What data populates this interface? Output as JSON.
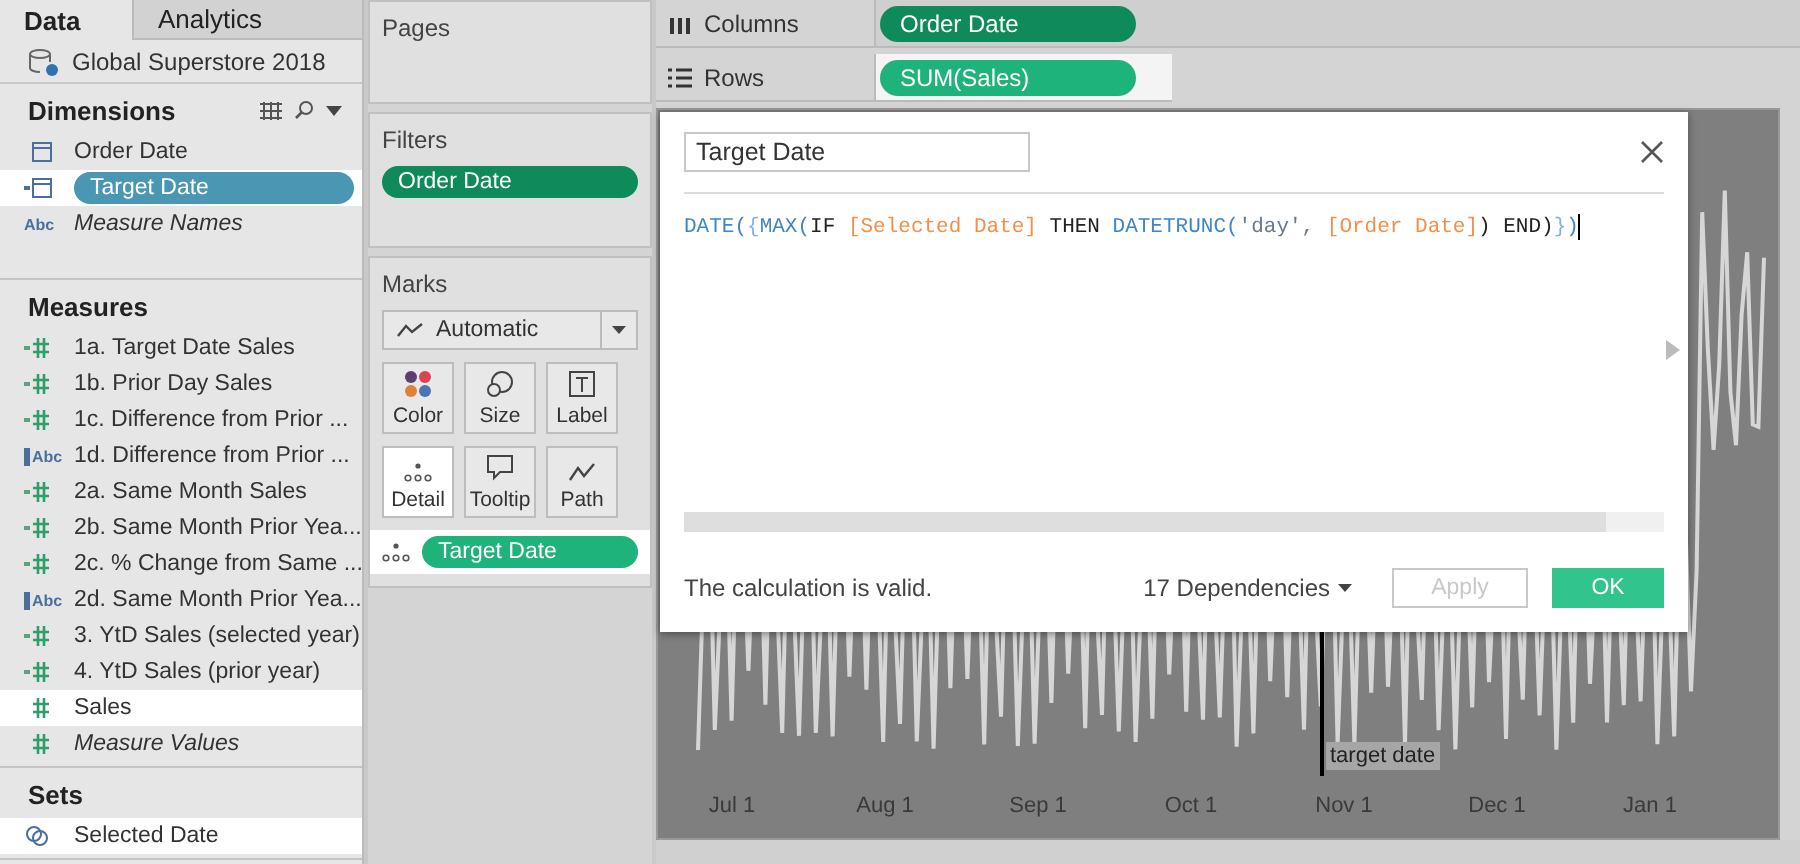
{
  "sidebar": {
    "tabs": [
      {
        "label": "Data",
        "selected": true
      },
      {
        "label": "Analytics",
        "selected": false
      }
    ],
    "data_source": "Global Superstore 2018",
    "sections": [
      {
        "title": "Dimensions",
        "tools": true,
        "items": [
          {
            "label": "Order Date",
            "kind": "date",
            "calculated": false,
            "italic": false,
            "highlighted": false,
            "pill": false
          },
          {
            "label": "Target Date",
            "kind": "date",
            "calculated": true,
            "italic": false,
            "highlighted": true,
            "pill": true
          },
          {
            "label": "Measure Names",
            "kind": "text",
            "type_label": "Abc",
            "calculated": false,
            "italic": true,
            "highlighted": false,
            "pill": false
          }
        ]
      },
      {
        "title": "Measures",
        "items": [
          {
            "label": "1a. Target Date Sales",
            "kind": "number",
            "calculated": true,
            "italic": false,
            "highlighted": false,
            "pill": false
          },
          {
            "label": "1b. Prior Day Sales",
            "kind": "number",
            "calculated": true,
            "italic": false,
            "highlighted": false,
            "pill": false
          },
          {
            "label": "1c. Difference from Prior ...",
            "kind": "number",
            "calculated": true,
            "italic": false,
            "highlighted": false,
            "pill": false
          },
          {
            "label": "1d. Difference from Prior ...",
            "kind": "text",
            "type_label": "Abc",
            "calculated": true,
            "italic": false,
            "highlighted": false,
            "pill": false
          },
          {
            "label": "2a. Same Month Sales",
            "kind": "number",
            "calculated": true,
            "italic": false,
            "highlighted": false,
            "pill": false
          },
          {
            "label": "2b. Same Month Prior Yea...",
            "kind": "number",
            "calculated": true,
            "italic": false,
            "highlighted": false,
            "pill": false
          },
          {
            "label": "2c. % Change from Same ...",
            "kind": "number",
            "calculated": true,
            "italic": false,
            "highlighted": false,
            "pill": false
          },
          {
            "label": "2d. Same Month Prior Yea...",
            "kind": "text",
            "type_label": "Abc",
            "calculated": true,
            "italic": false,
            "highlighted": false,
            "pill": false
          },
          {
            "label": "3. YtD Sales (selected year)",
            "kind": "number",
            "calculated": true,
            "italic": false,
            "highlighted": false,
            "pill": false
          },
          {
            "label": "4. YtD Sales (prior year)",
            "kind": "number",
            "calculated": true,
            "italic": false,
            "highlighted": false,
            "pill": false
          },
          {
            "label": "Sales",
            "kind": "number",
            "calculated": false,
            "italic": false,
            "highlighted": true,
            "pill": false
          },
          {
            "label": "Measure Values",
            "kind": "number",
            "calculated": false,
            "italic": true,
            "highlighted": false,
            "pill": false
          }
        ]
      },
      {
        "title": "Sets",
        "items": [
          {
            "label": "Selected Date",
            "kind": "set",
            "italic": false,
            "highlighted": true,
            "pill": false
          }
        ]
      }
    ]
  },
  "pages": {
    "title": "Pages"
  },
  "filters": {
    "title": "Filters",
    "pills": [
      {
        "label": "Order Date",
        "color": "#0f8a5b"
      }
    ]
  },
  "marks": {
    "title": "Marks",
    "mark_type": "Automatic",
    "cards": [
      {
        "label": "Color",
        "kind": "color",
        "highlighted": false
      },
      {
        "label": "Size",
        "kind": "size",
        "highlighted": false
      },
      {
        "label": "Label",
        "kind": "label",
        "highlighted": false
      },
      {
        "label": "Detail",
        "kind": "detail",
        "highlighted": true
      },
      {
        "label": "Tooltip",
        "kind": "tooltip",
        "highlighted": false
      },
      {
        "label": "Path",
        "kind": "path",
        "highlighted": false
      }
    ],
    "fields": [
      {
        "label": "Target Date",
        "kind": "detail",
        "color": "#1db37b",
        "highlighted": true
      }
    ]
  },
  "shelves": [
    {
      "label": "Columns",
      "kind": "columns",
      "pill": "Order Date",
      "color": "#0f8a5b",
      "highlighted": false
    },
    {
      "label": "Rows",
      "kind": "rows",
      "pill": "SUM(Sales)",
      "color": "#1db37b",
      "highlighted": true
    }
  ],
  "view": {
    "x_labels": [
      "Jul 1",
      "Aug 1",
      "Sep 1",
      "Oct 1",
      "Nov 1",
      "Dec 1",
      "Jan 1"
    ],
    "annotation": "target date"
  },
  "dialog": {
    "name": "Target Date",
    "formula": [
      {
        "text": "DATE(",
        "kind": "function"
      },
      {
        "text": "{",
        "kind": "brace"
      },
      {
        "text": "MAX(",
        "kind": "function"
      },
      {
        "text": "IF ",
        "kind": "keyword"
      },
      {
        "text": "[Selected Date]",
        "kind": "field"
      },
      {
        "text": " THEN ",
        "kind": "keyword"
      },
      {
        "text": "DATETRUNC(",
        "kind": "function"
      },
      {
        "text": "'day', ",
        "kind": "string"
      },
      {
        "text": "[Order Date]",
        "kind": "field"
      },
      {
        "text": ") END)",
        "kind": "keyword"
      },
      {
        "text": "}",
        "kind": "brace"
      },
      {
        "text": ")",
        "kind": "function"
      }
    ],
    "status": "The calculation is valid.",
    "dependencies": "17 Dependencies",
    "buttons": [
      {
        "label": "Apply",
        "kind": "secondary",
        "disabled": true
      },
      {
        "label": "OK",
        "kind": "primary",
        "disabled": false
      }
    ]
  }
}
